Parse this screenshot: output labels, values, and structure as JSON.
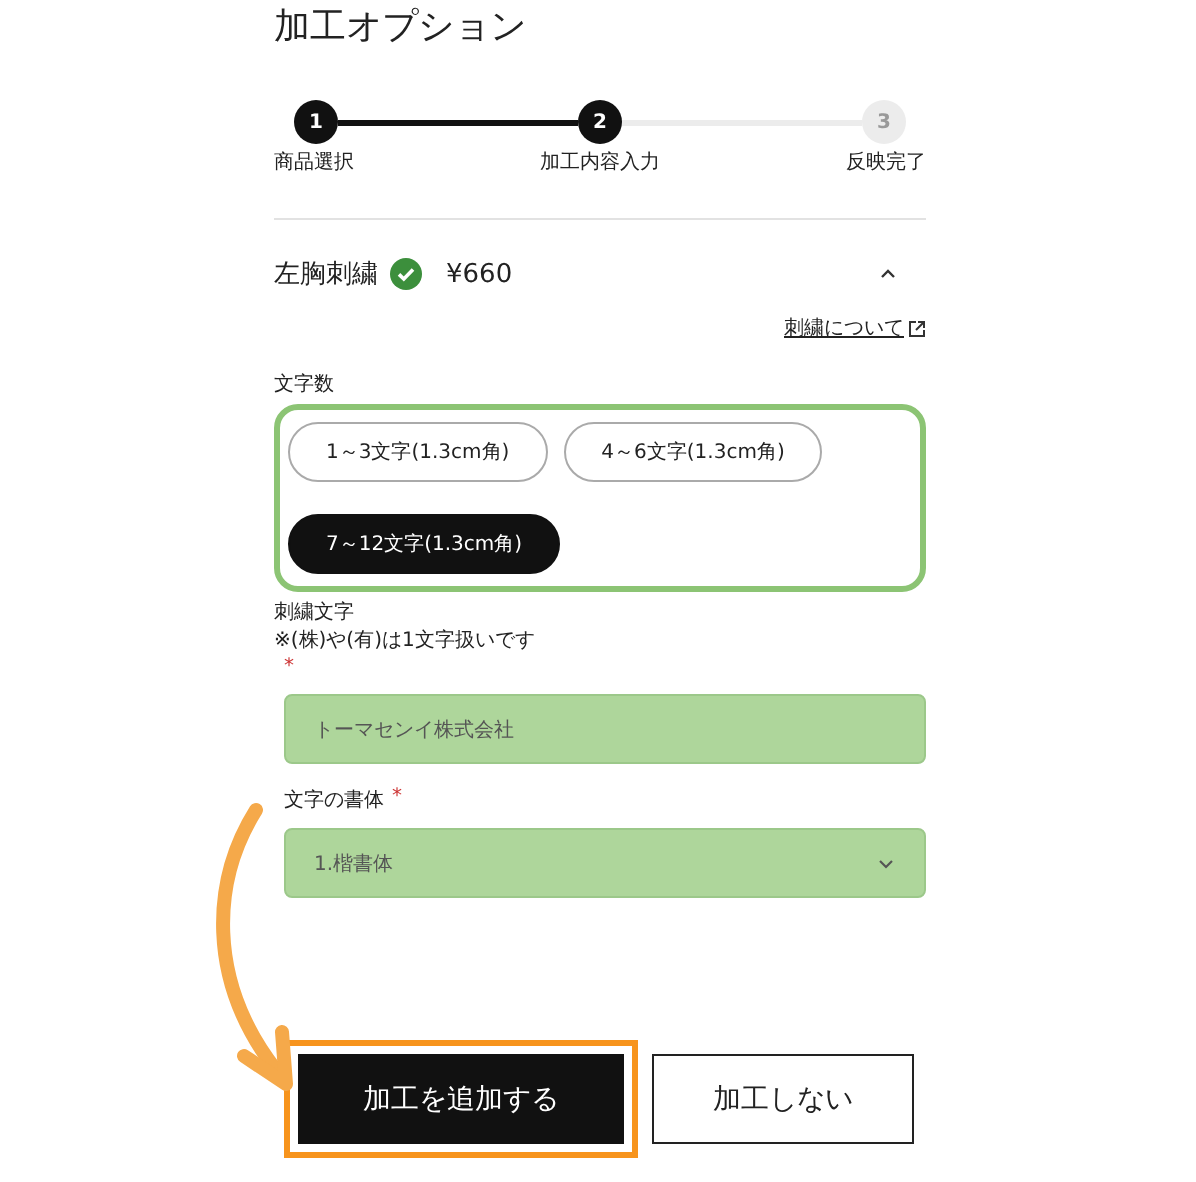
{
  "title": "加工オプション",
  "steps": [
    {
      "number": "1",
      "label": "商品選択",
      "reached": true
    },
    {
      "number": "2",
      "label": "加工内容入力",
      "reached": true
    },
    {
      "number": "3",
      "label": "反映完了",
      "reached": false
    }
  ],
  "section": {
    "title": "左胸刺繍",
    "checked": true,
    "price": "¥660",
    "expanded": true,
    "link": "刺繍について"
  },
  "char_count": {
    "label": "文字数",
    "highlighted": true,
    "options": [
      {
        "label": "1～3文字(1.3cm角)",
        "selected": false
      },
      {
        "label": "4～6文字(1.3cm角)",
        "selected": false
      },
      {
        "label": "7～12文字(1.3cm角)",
        "selected": true
      }
    ]
  },
  "text_field": {
    "label": "刺繍文字",
    "note": "※(株)や(有)は1文字扱いです",
    "required_mark": "*",
    "value": "トーマセンイ株式会社",
    "highlighted": true
  },
  "font_select": {
    "label": "文字の書体",
    "required_mark": "*",
    "value": "1.楷書体",
    "highlighted": true
  },
  "buttons": [
    {
      "label": "加工を追加する",
      "kind": "primary",
      "highlighted": true
    },
    {
      "label": "加工しない",
      "kind": "secondary",
      "highlighted": false
    }
  ]
}
